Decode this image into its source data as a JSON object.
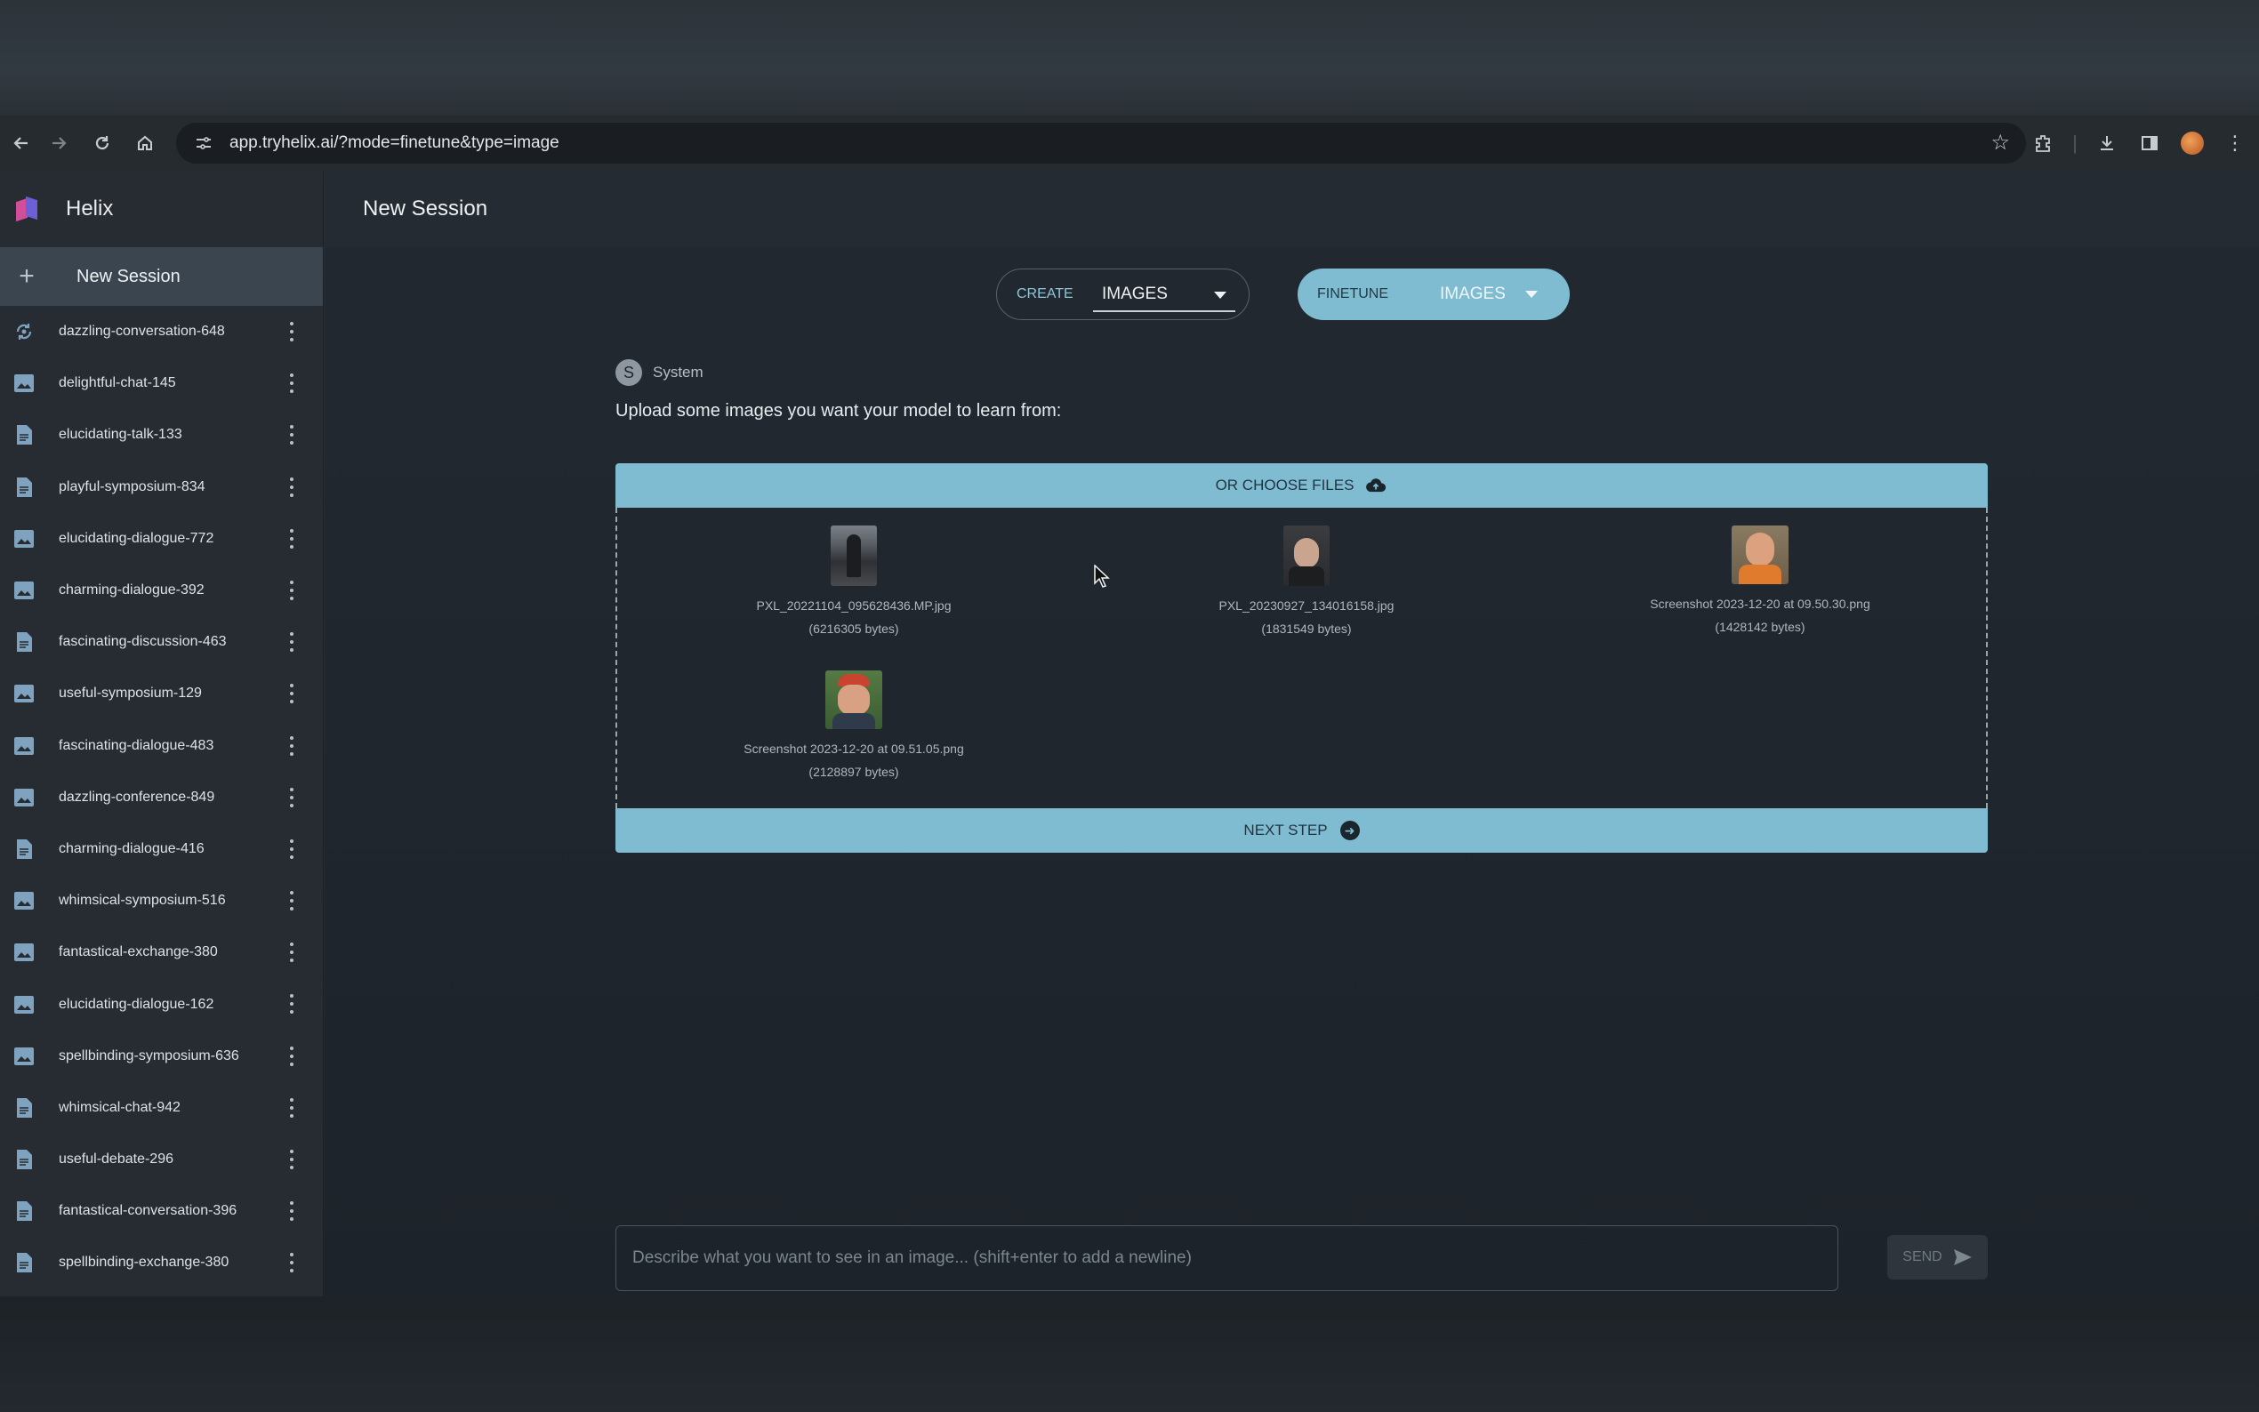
{
  "browser": {
    "url": "app.tryhelix.ai/?mode=finetune&type=image"
  },
  "app": {
    "brand": "Helix",
    "page_title": "New Session",
    "new_session_label": "New Session"
  },
  "sidebar": {
    "items": [
      {
        "label": "dazzling-conversation-648",
        "icon": "sync-icon"
      },
      {
        "label": "delightful-chat-145",
        "icon": "image-icon"
      },
      {
        "label": "elucidating-talk-133",
        "icon": "document-icon"
      },
      {
        "label": "playful-symposium-834",
        "icon": "document-icon"
      },
      {
        "label": "elucidating-dialogue-772",
        "icon": "image-icon"
      },
      {
        "label": "charming-dialogue-392",
        "icon": "image-icon"
      },
      {
        "label": "fascinating-discussion-463",
        "icon": "document-icon"
      },
      {
        "label": "useful-symposium-129",
        "icon": "image-icon"
      },
      {
        "label": "fascinating-dialogue-483",
        "icon": "image-icon"
      },
      {
        "label": "dazzling-conference-849",
        "icon": "image-icon"
      },
      {
        "label": "charming-dialogue-416",
        "icon": "document-icon"
      },
      {
        "label": "whimsical-symposium-516",
        "icon": "image-icon"
      },
      {
        "label": "fantastical-exchange-380",
        "icon": "image-icon"
      },
      {
        "label": "elucidating-dialogue-162",
        "icon": "image-icon"
      },
      {
        "label": "spellbinding-symposium-636",
        "icon": "image-icon"
      },
      {
        "label": "whimsical-chat-942",
        "icon": "document-icon"
      },
      {
        "label": "useful-debate-296",
        "icon": "document-icon"
      },
      {
        "label": "fantastical-conversation-396",
        "icon": "document-icon"
      },
      {
        "label": "spellbinding-exchange-380",
        "icon": "document-icon"
      }
    ]
  },
  "mode": {
    "create_label": "CREATE",
    "create_type": "IMAGES",
    "finetune_label": "FINETUNE",
    "finetune_type": "IMAGES"
  },
  "system": {
    "avatar_letter": "S",
    "name": "System",
    "message": "Upload some images you want your model to learn from:"
  },
  "upload": {
    "choose_files_label": "OR CHOOSE FILES",
    "next_step_label": "NEXT STEP",
    "files": [
      {
        "name": "PXL_20221104_095628436.MP.jpg",
        "size": "(6216305 bytes)"
      },
      {
        "name": "PXL_20230927_134016158.jpg",
        "size": "(1831549 bytes)"
      },
      {
        "name": "Screenshot 2023-12-20 at 09.50.30.png",
        "size": "(1428142 bytes)"
      },
      {
        "name": "Screenshot 2023-12-20 at 09.51.05.png",
        "size": "(2128897 bytes)"
      }
    ]
  },
  "prompt": {
    "placeholder": "Describe what you want to see in an image... (shift+enter to add a newline)",
    "send_label": "SEND"
  },
  "colors": {
    "accent": "#7fbcd1",
    "sidebar_bg": "#262c32",
    "main_bg": "#222931"
  }
}
